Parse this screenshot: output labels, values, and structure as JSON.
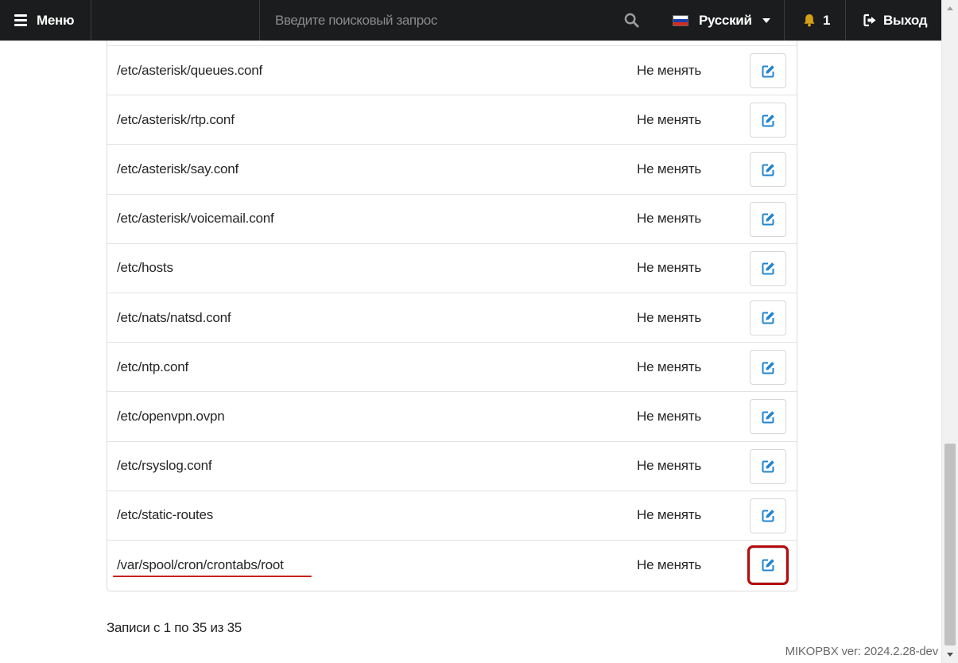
{
  "topbar": {
    "menu_label": "Меню",
    "search_placeholder": "Введите поисковый запрос",
    "language": "Русский",
    "notifications_count": "1",
    "logout_label": "Выход"
  },
  "table": {
    "rows": [
      {
        "path": "/etc/asterisk/queues.conf",
        "mode": "Не менять"
      },
      {
        "path": "/etc/asterisk/rtp.conf",
        "mode": "Не менять"
      },
      {
        "path": "/etc/asterisk/say.conf",
        "mode": "Не менять"
      },
      {
        "path": "/etc/asterisk/voicemail.conf",
        "mode": "Не менять"
      },
      {
        "path": "/etc/hosts",
        "mode": "Не менять"
      },
      {
        "path": "/etc/nats/natsd.conf",
        "mode": "Не менять"
      },
      {
        "path": "/etc/ntp.conf",
        "mode": "Не менять"
      },
      {
        "path": "/etc/openvpn.ovpn",
        "mode": "Не менять"
      },
      {
        "path": "/etc/rsyslog.conf",
        "mode": "Не менять"
      },
      {
        "path": "/etc/static-routes",
        "mode": "Не менять"
      },
      {
        "path": "/var/spool/cron/crontabs/root",
        "mode": "Не менять"
      }
    ]
  },
  "footer": {
    "records_info": "Записи с 1 по 35 из 35",
    "version": "MIKOPBX ver: 2024.2.28-dev"
  },
  "colors": {
    "topbar_bg": "#1b1c1d",
    "edit_icon": "#2185d0",
    "highlight": "#b40c0c",
    "bell": "#d4a017"
  }
}
